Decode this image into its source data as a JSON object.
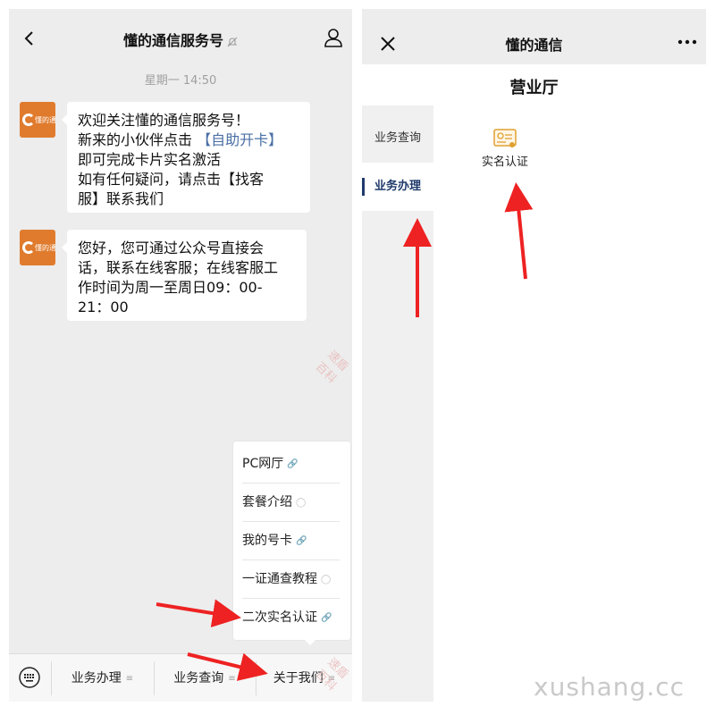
{
  "left": {
    "nav": {
      "title": "懂的通信服务号"
    },
    "time_label": "星期一 14:50",
    "messages": [
      {
        "avatar_text": "懂的通信",
        "line1": "欢迎关注懂的通信服务号！",
        "line2_prefix": "新来的小伙伴点击",
        "line2_link": "【自助开卡】",
        "line3": "即可完成卡片实名激活",
        "line4": "如有任何疑问，请点击【找客",
        "line5": "服】联系我们"
      },
      {
        "avatar_text": "懂的通信",
        "line1": "您好，您可通过公众号直接会",
        "line2": "话，联系在线客服；在线客服工",
        "line3": "作时间为周一至周日09：00-",
        "line4": "21：00"
      }
    ],
    "popup": {
      "items": [
        {
          "label": "PC网厅"
        },
        {
          "label": "套餐介绍"
        },
        {
          "label": "我的号卡"
        },
        {
          "label": "一证通查教程"
        },
        {
          "label": "二次实名认证"
        }
      ]
    },
    "menu": {
      "items": [
        {
          "label": "业务办理"
        },
        {
          "label": "业务查询"
        },
        {
          "label": "关于我们"
        }
      ]
    }
  },
  "right": {
    "title": "懂的通信",
    "hall_title": "营业厅",
    "side_nav": [
      {
        "label": "业务查询"
      },
      {
        "label": "业务办理"
      }
    ],
    "service": {
      "label": "实名认证"
    }
  },
  "watermark": {
    "text": "速盾百科"
  },
  "site_mark": "xushang.cc",
  "colors": {
    "arrow": "#ee2222",
    "link": "#4a6fa5",
    "active_nav": "#1f3a6b",
    "avatar": "#e07b2e"
  }
}
